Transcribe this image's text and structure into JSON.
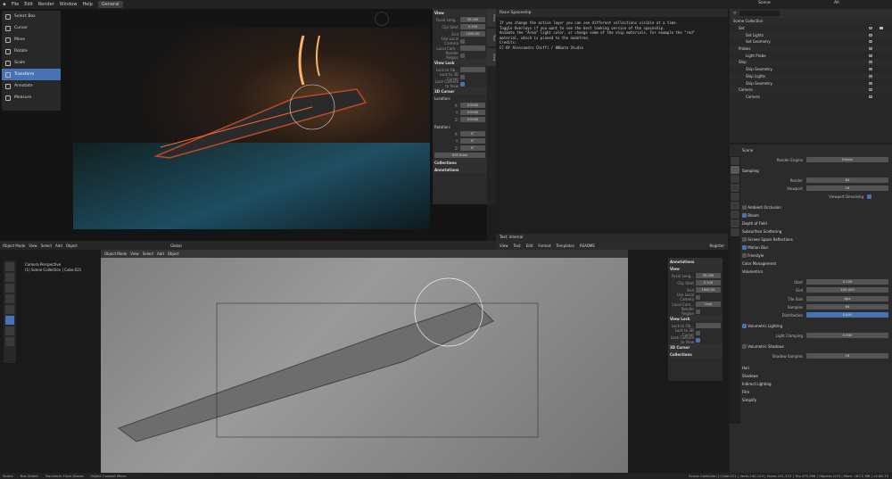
{
  "menubar": {
    "items": [
      "File",
      "Edit",
      "Render",
      "Window",
      "Help"
    ],
    "workspace": "General",
    "scene": "Scene",
    "view_layer": "All"
  },
  "toolbar": {
    "items": [
      "Select Box",
      "Cursor",
      "Move",
      "Rotate",
      "Scale",
      "Transform",
      "Annotate",
      "Measure"
    ]
  },
  "npanel": {
    "view": "View",
    "focal_label": "Focal Leng...",
    "focal_val": "35.000",
    "clip_label": "Clip Start",
    "clip_val": "0.100",
    "end_label": "End",
    "end_val": "1000.00",
    "local_cam": "Use Local Camera",
    "local_cam2": "Local Cam...",
    "render_region": "Render Region",
    "view_lock": "View Lock",
    "lock_obj": "Lock to Ob...",
    "lock_3d": "Lock to 3D Cursor",
    "lock_cam": "Lock Camera to View",
    "cursor": "3D Cursor",
    "location": "Location:",
    "x_label": "X:",
    "x_val": "0.0000",
    "y_label": "Y:",
    "y_val": "0.0000",
    "z_label": "Z:",
    "z_val": "0.0000",
    "rotation": "Rotation:",
    "rx_val": "0°",
    "ry_val": "0°",
    "rz_val": "0°",
    "euler": "XYZ Euler",
    "collections": "Collections",
    "annotations": "Annotations",
    "tabs": [
      "Item",
      "Tool",
      "View"
    ]
  },
  "textpanel": {
    "title": "Race Spaceship",
    "lines": [
      "If you change the active layer you can see different collections visible at a time.",
      "",
      "Toggle Overlays if you want to see the best looking version of the spaceship.",
      "",
      "Animate the \"Area\" light color, or change some of the ship materials. For example the \"red\"",
      "material, which is pinned to the nodetree.",
      "",
      "Credits:",
      "CC-BY Alessandro Chiffi / 0Nbata Studio"
    ],
    "footer": "Text: Internal",
    "menu": [
      "View",
      "Text",
      "Edit",
      "Format",
      "Templates"
    ],
    "file": "README",
    "register": "Register"
  },
  "outliner": {
    "search": "",
    "rows": [
      "Scene Collection",
      "Set",
      "Set Lights",
      "Set Geometry",
      "Probes",
      "Light Probe",
      "Ship",
      "Ship Geometry",
      "Ship Lights",
      "Ship Geometry",
      "Camera",
      "Camera"
    ]
  },
  "props": {
    "scene": "Scene",
    "engine_label": "Render Engine",
    "engine": "Eevee",
    "sampling": "Sampling",
    "render_label": "Render",
    "render_val": "64",
    "viewport_label": "Viewport",
    "viewport_val": "16",
    "vp_denoise": "Viewport Denoising",
    "sections": [
      "Ambient Occlusion",
      "Bloom",
      "Depth of Field",
      "Subsurface Scattering",
      "Screen Space Reflections",
      "Motion Blur",
      "Freestyle",
      "Color Management",
      "Volumetrics"
    ],
    "start_label": "Start",
    "start_val": "0.100",
    "end_label": "End",
    "end_val": "100.000",
    "tile_label": "Tile Size",
    "tile_val": "8px",
    "samples_label": "Samples",
    "samples_val": "64",
    "dist_label": "Distribution",
    "dist_val": "0.800",
    "vol_light": "Volumetric Lighting",
    "clamp_label": "Light Clamping",
    "clamp_val": "0.000",
    "vol_shadows": "Volumetric Shadows",
    "shadow_samples_label": "Shadow Samples",
    "shadow_samples_val": "16",
    "more": [
      "Hair",
      "Shadows",
      "Indirect Lighting",
      "Film",
      "Simplify"
    ]
  },
  "vp2": {
    "mode": "Object Mode",
    "menus": [
      "View",
      "Select",
      "Add",
      "Object"
    ],
    "transform": "Global",
    "persp": "Camera Perspective",
    "coll": "(1) Scene Collection | Cube.021",
    "mode2": "Object Mode",
    "menus2": [
      "View",
      "Select",
      "Add",
      "Object"
    ]
  },
  "n2": {
    "annotations": "Annotations",
    "view": "View",
    "focal_label": "Focal Leng...",
    "focal_val": "35.000",
    "clip_label": "Clip Start",
    "clip_val": "0.100",
    "end_label": "End",
    "end_val": "1000.00",
    "local": "Use Local Camera",
    "local2": "Local Cam...",
    "cam": "Cam",
    "render_region": "Render Region",
    "view_lock": "View Lock",
    "lock_obj": "Lock to Ob...",
    "lock_3d": "Lock to 3D Cursor",
    "lock_cam": "Lock Camera to View",
    "cursor": "3D Cursor",
    "collections": "Collections"
  },
  "status": {
    "select": "Select",
    "box": "Box Select",
    "transform": "Transform From Gizmo",
    "context": "Object Context Menu",
    "stats": "Scene Collection | Cube.021 | Verts:240,144 | Faces:241,333 | Tris:479,366 | Objects:1/33 | Mem: 187.2 MB | v2.80.75"
  }
}
